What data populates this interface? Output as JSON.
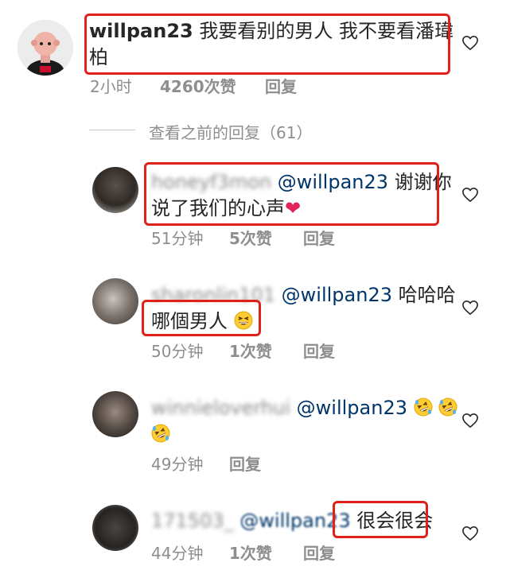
{
  "comment_main": {
    "username": "willpan23",
    "text_line1": "我要看别的男人 我不要看潘瑋",
    "text_line2": "柏",
    "time": "2小时",
    "likes": "4260次赞",
    "reply": "回复"
  },
  "view_prev": "查看之前的回复（61）",
  "replies": [
    {
      "username": "honeyf3mon",
      "mention": "@willpan23",
      "text_line1": "谢谢你",
      "text_line2": "说了我们的心声",
      "time": "51分钟",
      "likes": "5次赞",
      "reply": "回复"
    },
    {
      "username": "sharonlin101",
      "mention": "@willpan23",
      "text_line1": "哈哈哈",
      "text_line2": "哪個男人",
      "time": "50分钟",
      "likes": "1次赞",
      "reply": "回复"
    },
    {
      "username": "winnieloverhui",
      "mention": "@willpan23",
      "time": "49分钟",
      "reply": "回复"
    },
    {
      "username": "171503_",
      "mention": "@willpan23",
      "text_line1": "很会很会",
      "time": "44分钟",
      "likes": "1次赞",
      "reply": "回复"
    }
  ],
  "icons": {
    "like": "heart-outline-icon",
    "emoji_grin": "grinning-squinting-face",
    "emoji_rofl": "rolling-on-floor-laughing"
  },
  "colors": {
    "highlight_box": "#e0201b",
    "mention": "#003569",
    "muted": "#8e8e8e"
  }
}
